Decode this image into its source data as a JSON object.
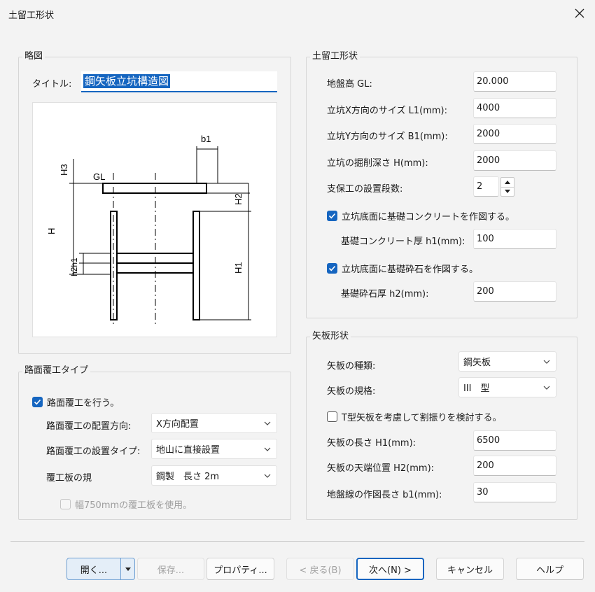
{
  "window": {
    "title": "土留工形状"
  },
  "sketch": {
    "group_label": "略図",
    "title_label": "タイトル:",
    "title_value": "鋼矢板立坑構造図",
    "labels": {
      "b1": "b1",
      "H3": "H3",
      "GL": "GL",
      "H2": "H2",
      "H": "H",
      "h2h1": "h2h1",
      "H1": "H1"
    }
  },
  "shape": {
    "group_label": "土留工形状",
    "ground_level": {
      "label": "地盤高 GL:",
      "value": "20.000"
    },
    "shaft_x": {
      "label": "立坑X方向のサイズ L1(mm):",
      "value": "4000"
    },
    "shaft_y": {
      "label": "立坑Y方向のサイズ B1(mm):",
      "value": "2000"
    },
    "depth": {
      "label": "立坑の掘削深さ H(mm):",
      "value": "2000"
    },
    "support_stages": {
      "label": "支保工の設置段数:",
      "value": "2"
    },
    "concrete_check": {
      "label": "立坑底面に基礎コンクリートを作図する。",
      "checked": true
    },
    "concrete_thickness": {
      "label": "基礎コンクリート厚 h1(mm):",
      "value": "100"
    },
    "gravel_check": {
      "label": "立坑底面に基礎砕石を作図する。",
      "checked": true
    },
    "gravel_thickness": {
      "label": "基礎砕石厚 h2(mm):",
      "value": "200"
    }
  },
  "road": {
    "group_label": "路面覆工タイプ",
    "enable": {
      "label": "路面覆工を行う。",
      "checked": true
    },
    "direction": {
      "label": "路面覆工の配置方向:",
      "value": "X方向配置"
    },
    "install_type": {
      "label": "路面覆工の設置タイプ:",
      "value": "地山に直接設置"
    },
    "board_spec": {
      "label": "覆工板の規",
      "value": "鋼製　長さ 2m"
    },
    "use_750": {
      "label": "幅750mmの覆工板を使用。",
      "checked": false
    }
  },
  "sheet": {
    "group_label": "矢板形状",
    "kind": {
      "label": "矢板の種類:",
      "value": "鋼矢板"
    },
    "standard": {
      "label": "矢板の規格:",
      "value": "III　型"
    },
    "t_check": {
      "label": "T型矢板を考慮して割振りを検討する。",
      "checked": false
    },
    "length": {
      "label": "矢板の長さ H1(mm):",
      "value": "6500"
    },
    "top_pos": {
      "label": "矢板の天端位置 H2(mm):",
      "value": "200"
    },
    "ground_line": {
      "label": "地盤線の作図長さ b1(mm):",
      "value": "30"
    }
  },
  "buttons": {
    "open": "開く...",
    "save": "保存...",
    "properties": "プロパティ...",
    "back": "< 戻る(B)",
    "next": "次へ(N) >",
    "cancel": "キャンセル",
    "help": "ヘルプ"
  },
  "colors": {
    "accent": "#1565c0"
  },
  "icons": [
    "close-icon",
    "chevron-down-icon",
    "check-icon",
    "spin-up-icon",
    "spin-down-icon",
    "dropdown-arrow-icon"
  ]
}
